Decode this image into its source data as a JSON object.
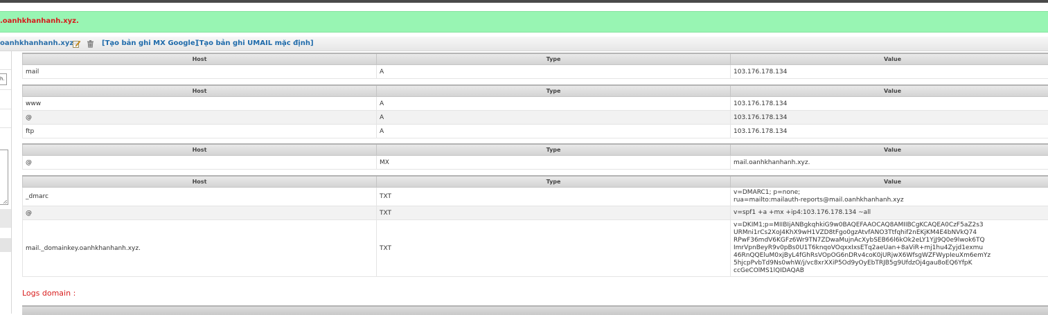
{
  "notice": {
    "text": ".oanhkhanhanh.xyz."
  },
  "toolbar": {
    "domain": "oanhkhanhanh.xyz",
    "edit_icon": "edit-icon",
    "delete_icon": "trash-icon",
    "link_mx_google": "[Tạo bản ghi MX Google]",
    "link_umail_default": "[Tạo bản ghi UMAIL mặc định]"
  },
  "left": {
    "input_text": "h."
  },
  "columns": {
    "host": "Host",
    "type": "Type",
    "value": "Value"
  },
  "tables": [
    {
      "rows": [
        {
          "host": "mail",
          "type": "A",
          "value": "103.176.178.134"
        }
      ]
    },
    {
      "rows": [
        {
          "host": "www",
          "type": "A",
          "value": "103.176.178.134"
        },
        {
          "host": "@",
          "type": "A",
          "value": "103.176.178.134"
        },
        {
          "host": "ftp",
          "type": "A",
          "value": "103.176.178.134"
        }
      ]
    },
    {
      "rows": [
        {
          "host": "@",
          "type": "MX",
          "value": "mail.oanhkhanhanh.xyz."
        }
      ]
    },
    {
      "rows": [
        {
          "host": "_dmarc",
          "type": "TXT",
          "value_lines": [
            "v=DMARC1; p=none;",
            "rua=mailto:mailauth-reports@mail.oanhkhanhanh.xyz"
          ]
        },
        {
          "host": "@",
          "type": "TXT",
          "value_lines": [
            "v=spf1 +a +mx +ip4:103.176.178.134 ~all"
          ]
        },
        {
          "host": "mail._domainkey.oanhkhanhanh.xyz.",
          "type": "TXT",
          "value_lines": [
            "v=DKIM1;p=MIIBIjANBgkqhkiG9w0BAQEFAAOCAQ8AMIIBCgKCAQEA0CzF5aZ2s3",
            "URMni1rCs2XoJ4KhX9wH1VZD8tFgo0gzAtvfANO3Ttfqhif2nEKjKM4E4bNVkQ74",
            "RPwF36mdV6KGFz6Wr9TN7ZDwaMujnAcXybSEB66l6kOk2eLY1YjJ9Q0e9lwok6TQ",
            "ImrVpnBeyR9v0pBs0U1T6knqoVOqxxIxsETq2aeUan+8aViR+mj1hu4Zyjd1exmu",
            "46RnQQEluM0xjByL4fGhRsVOpOG6nDRv4coK0jURjwX6WfsgWZFWypIeuXm6emYz",
            "5hjcpPvbTd9Ns0whW/j/vc8xrXXiP5Od9yOyEbTRJB5g9UfdzOj4gau8oEQ6YfpK",
            "ccGeCOlMS1lQIDAQAB"
          ]
        }
      ]
    }
  ],
  "logs": {
    "title": "Logs domain :"
  }
}
